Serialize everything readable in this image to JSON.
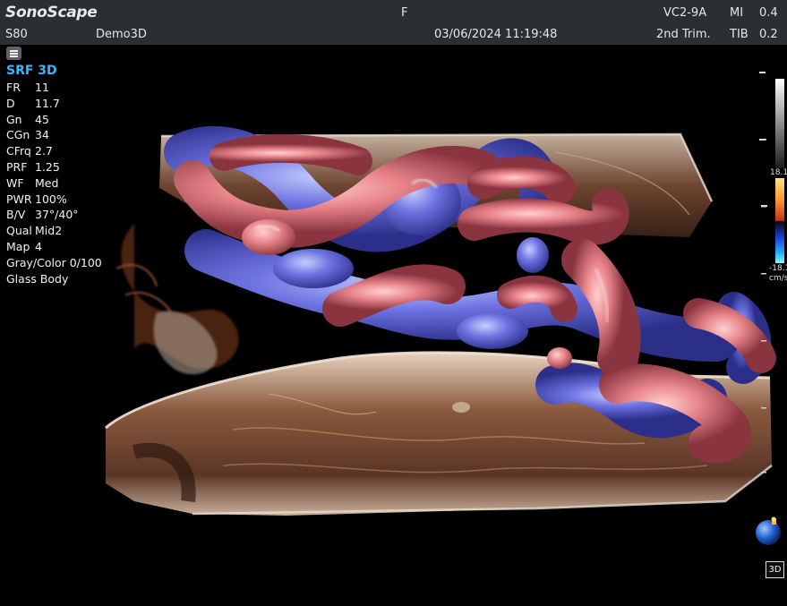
{
  "header": {
    "brand": "SonoScape",
    "focus_marker": "F",
    "probe": "VC2-9A",
    "mi_label": "MI",
    "mi_value": "0.4",
    "system": "S80",
    "patient": "Demo3D",
    "datetime": "03/06/2024 11:19:48",
    "exam_preset": "2nd Trim.",
    "tib_label": "TIB",
    "tib_value": "0.2"
  },
  "params": {
    "mode_title": "SRF 3D",
    "rows": [
      {
        "k": "FR",
        "v": "11"
      },
      {
        "k": "D",
        "v": "11.7"
      },
      {
        "k": "Gn",
        "v": "45"
      },
      {
        "k": "CGn",
        "v": "34"
      },
      {
        "k": "CFrq",
        "v": "2.7"
      },
      {
        "k": "PRF",
        "v": "1.25"
      },
      {
        "k": "WF",
        "v": "Med"
      },
      {
        "k": "PWR",
        "v": "100%"
      },
      {
        "k": "B/V",
        "v": "37°/40°"
      },
      {
        "k": "Qual",
        "v": "Mid2"
      },
      {
        "k": "Map",
        "v": "4"
      },
      {
        "k": "Gray/Color",
        "v": "0/100"
      },
      {
        "k": "Glass Body",
        "v": ""
      }
    ]
  },
  "color_scale": {
    "top_value": "18.1",
    "bottom_value": "-18.1",
    "unit": "cm/s",
    "positive_color": "#ff9a2e",
    "negative_color": "#1fb3ff"
  },
  "controls": {
    "view_3d_label": "3D"
  },
  "icons": {
    "menu": "menu-icon",
    "orientation": "orientation-sphere-icon"
  },
  "colors": {
    "header_bg": "#2b2e33",
    "mode_title": "#3ab6ff",
    "artery": "#e8848a",
    "vein": "#6c72e0",
    "tissue": "#b07050"
  }
}
